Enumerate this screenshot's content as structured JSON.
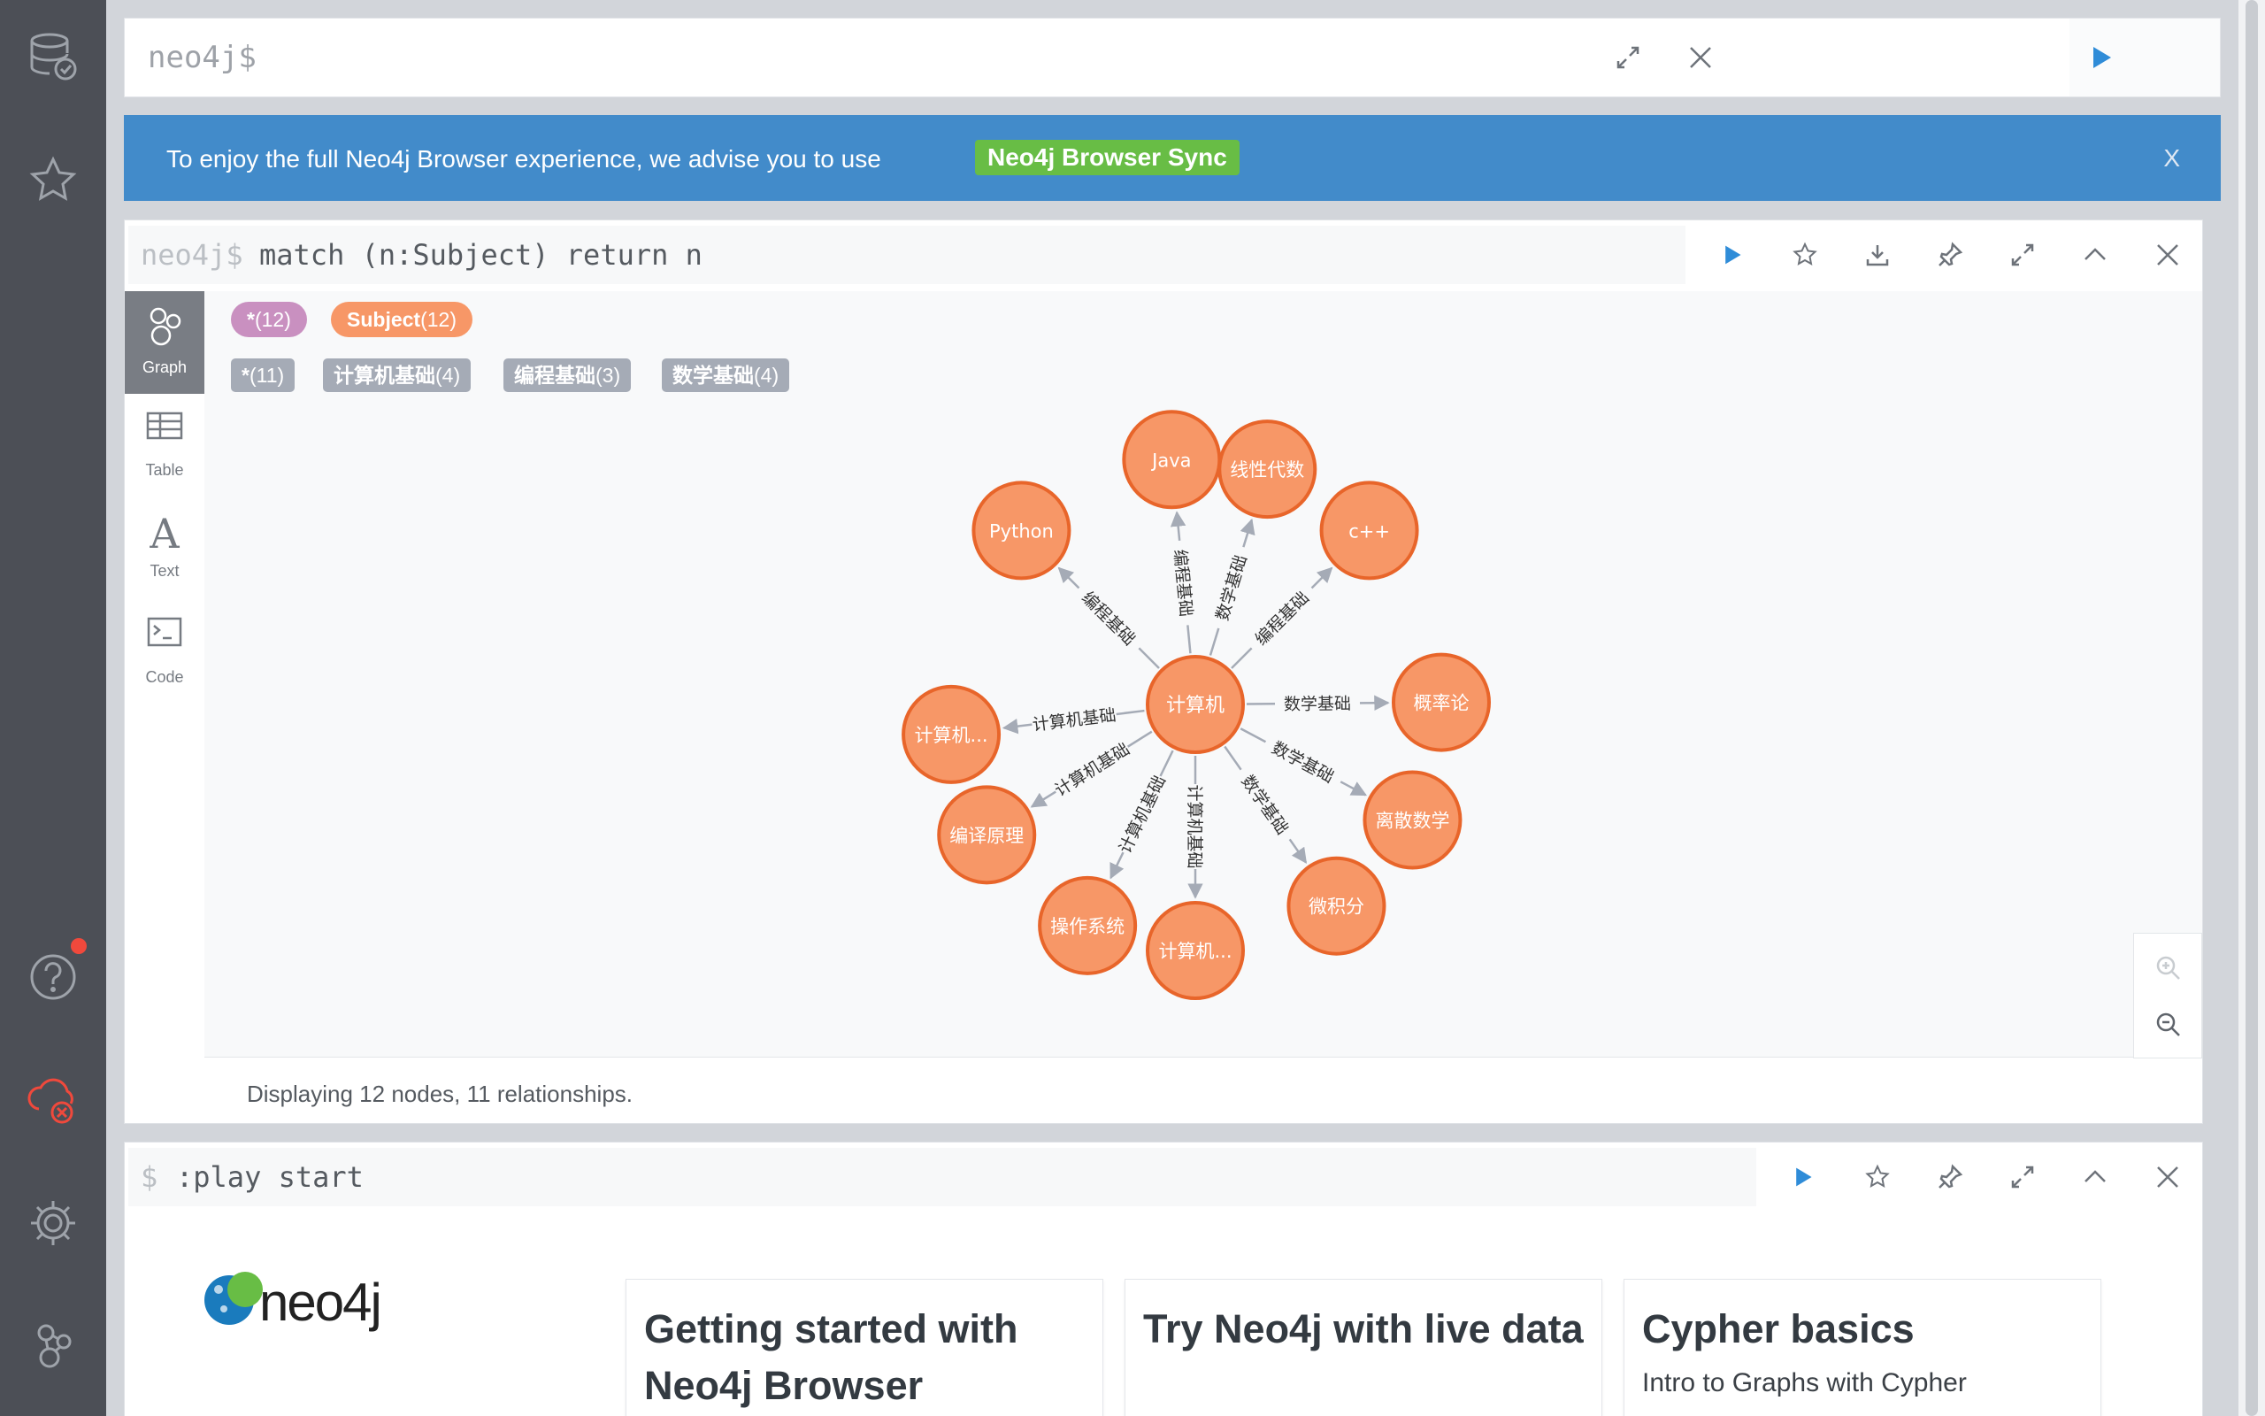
{
  "sidebar": {
    "notification_active": true
  },
  "editor": {
    "prompt": "neo4j$"
  },
  "banner": {
    "message": "To enjoy the full Neo4j Browser experience, we advise you to use",
    "link_label": "Neo4j Browser Sync",
    "close_label": "X"
  },
  "frame1": {
    "prompt": "neo4j$",
    "query": "match (n:Subject) return n",
    "tabs": [
      {
        "label": "Graph",
        "active": true
      },
      {
        "label": "Table",
        "active": false
      },
      {
        "label": "Text",
        "active": false
      },
      {
        "label": "Code",
        "active": false
      }
    ],
    "node_labels": [
      {
        "label": "*",
        "count": "(12)",
        "color": "#c990c0"
      },
      {
        "label": "Subject",
        "count": "(12)",
        "color": "#f79767"
      }
    ],
    "rel_types": [
      {
        "label": "*",
        "count": "(11)"
      },
      {
        "label": "计算机基础",
        "count": "(4)"
      },
      {
        "label": "编程基础",
        "count": "(3)"
      },
      {
        "label": "数学基础",
        "count": "(4)"
      }
    ],
    "status": "Displaying 12 nodes, 11 relationships.",
    "graph": {
      "node_fill": "#f79767",
      "node_stroke": "#e8652a",
      "center": "计算机",
      "nodes": [
        {
          "label": "Java",
          "rel": "编程基础"
        },
        {
          "label": "线性代数",
          "rel": "数学基础"
        },
        {
          "label": "c++",
          "rel": "编程基础"
        },
        {
          "label": "概率论",
          "rel": "数学基础"
        },
        {
          "label": "离散数学",
          "rel": "数学基础"
        },
        {
          "label": "微积分",
          "rel": "数学基础"
        },
        {
          "label": "计算机...",
          "rel": "计算机基础"
        },
        {
          "label": "操作系统",
          "rel": "计算机基础"
        },
        {
          "label": "编译原理",
          "rel": "计算机基础"
        },
        {
          "label": "计算机...",
          "rel": "计算机基础"
        },
        {
          "label": "Python",
          "rel": "编程基础"
        }
      ]
    }
  },
  "frame2": {
    "prompt": "$",
    "query": ":play start",
    "logo_text": "neo4j",
    "cards": [
      {
        "title": "Getting started with Neo4j Browser",
        "subtitle": ""
      },
      {
        "title": "Try Neo4j with live data",
        "subtitle": ""
      },
      {
        "title": "Cypher basics",
        "subtitle": "Intro to Graphs with Cypher"
      }
    ]
  }
}
